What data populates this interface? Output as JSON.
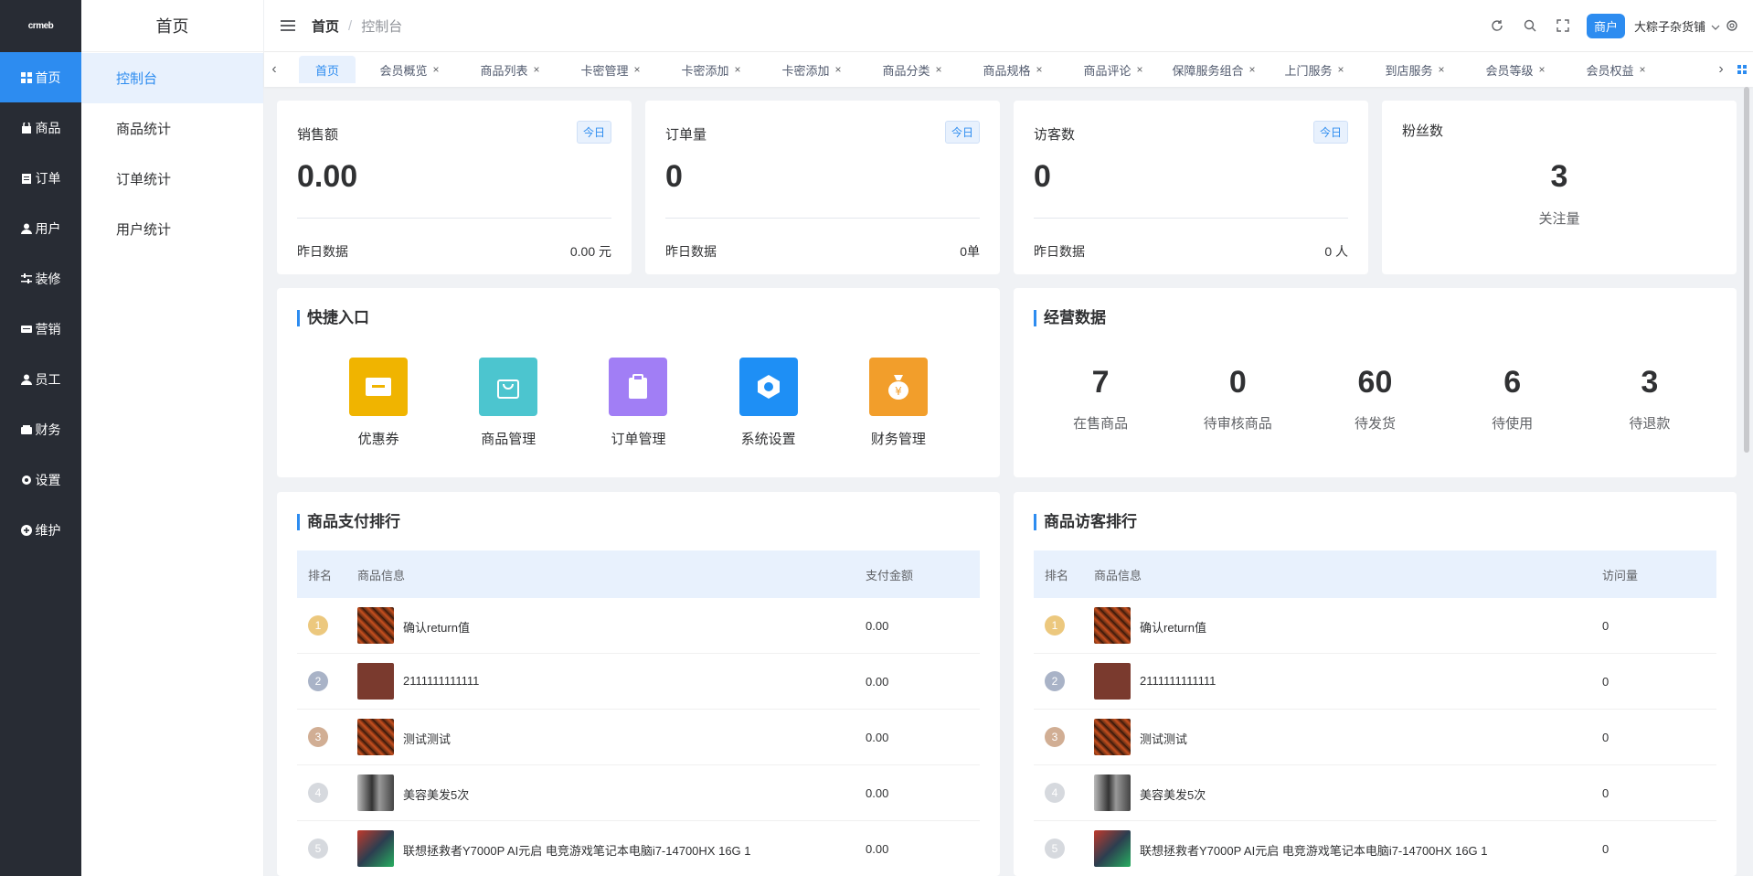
{
  "sidebar": {
    "logo": "crmeb",
    "items": [
      {
        "label": "首页",
        "icon": "grid-icon"
      },
      {
        "label": "商品",
        "icon": "bag-icon"
      },
      {
        "label": "订单",
        "icon": "clipboard-icon"
      },
      {
        "label": "用户",
        "icon": "user-icon"
      },
      {
        "label": "装修",
        "icon": "sliders-icon"
      },
      {
        "label": "营销",
        "icon": "ticket-icon"
      },
      {
        "label": "员工",
        "icon": "user-icon"
      },
      {
        "label": "财务",
        "icon": "wallet-icon"
      },
      {
        "label": "设置",
        "icon": "gear-icon"
      },
      {
        "label": "维护",
        "icon": "plus-circle-icon"
      }
    ]
  },
  "submenu": {
    "title": "首页",
    "items": [
      "控制台",
      "商品统计",
      "订单统计",
      "用户统计"
    ]
  },
  "header": {
    "breadcrumb_home": "首页",
    "breadcrumb_sep": "/",
    "breadcrumb_current": "控制台",
    "merchant_label": "商户",
    "shop_name": "大粽子杂货铺"
  },
  "tabs": [
    "首页",
    "会员概览",
    "商品列表",
    "卡密管理",
    "卡密添加",
    "卡密添加",
    "商品分类",
    "商品规格",
    "商品评论",
    "保障服务组合",
    "上门服务",
    "到店服务",
    "会员等级",
    "会员权益"
  ],
  "stats": [
    {
      "label": "销售额",
      "badge": "今日",
      "value": "0.00",
      "foot_label": "昨日数据",
      "foot_value": "0.00 元"
    },
    {
      "label": "订单量",
      "badge": "今日",
      "value": "0",
      "foot_label": "昨日数据",
      "foot_value": "0单"
    },
    {
      "label": "访客数",
      "badge": "今日",
      "value": "0",
      "foot_label": "昨日数据",
      "foot_value": "0 人"
    }
  ],
  "fans": {
    "label": "粉丝数",
    "value": "3",
    "sub": "关注量"
  },
  "quick": {
    "title": "快捷入口",
    "items": [
      {
        "label": "优惠券",
        "color": "#f0b400"
      },
      {
        "label": "商品管理",
        "color": "#4cc5cf"
      },
      {
        "label": "订单管理",
        "color": "#a17ef5"
      },
      {
        "label": "系统设置",
        "color": "#1e8ff5"
      },
      {
        "label": "财务管理",
        "color": "#f29e2b"
      }
    ]
  },
  "business": {
    "title": "经营数据",
    "items": [
      {
        "value": "7",
        "label": "在售商品"
      },
      {
        "value": "0",
        "label": "待审核商品"
      },
      {
        "value": "60",
        "label": "待发货"
      },
      {
        "value": "6",
        "label": "待使用"
      },
      {
        "value": "3",
        "label": "待退款"
      }
    ]
  },
  "pay_rank": {
    "title": "商品支付排行",
    "headers": [
      "排名",
      "商品信息",
      "支付金额"
    ],
    "rows": [
      {
        "rank": "1",
        "name": "确认return值",
        "value": "0.00"
      },
      {
        "rank": "2",
        "name": "2111111111111",
        "value": "0.00"
      },
      {
        "rank": "3",
        "name": "测试测试",
        "value": "0.00"
      },
      {
        "rank": "4",
        "name": "美容美发5次",
        "value": "0.00"
      },
      {
        "rank": "5",
        "name": "联想拯救者Y7000P AI元启 电竞游戏笔记本电脑i7-14700HX 16G 1",
        "value": "0.00"
      }
    ]
  },
  "visit_rank": {
    "title": "商品访客排行",
    "headers": [
      "排名",
      "商品信息",
      "访问量"
    ],
    "rows": [
      {
        "rank": "1",
        "name": "确认return值",
        "value": "0"
      },
      {
        "rank": "2",
        "name": "2111111111111",
        "value": "0"
      },
      {
        "rank": "3",
        "name": "测试测试",
        "value": "0"
      },
      {
        "rank": "4",
        "name": "美容美发5次",
        "value": "0"
      },
      {
        "rank": "5",
        "name": "联想拯救者Y7000P AI元启 电竞游戏笔记本电脑i7-14700HX 16G 1",
        "value": "0"
      }
    ]
  },
  "colors": {
    "accent": "#2d8cf0",
    "sidebar": "#282c34"
  }
}
